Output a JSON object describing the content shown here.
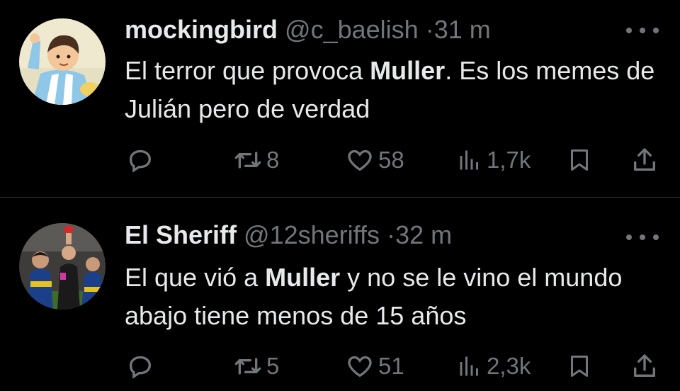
{
  "tweets": [
    {
      "name": "mockingbird",
      "handle": "@c_baelish",
      "separator": "·",
      "time": "31 m",
      "text_parts": [
        "El terror que provoca ",
        "Muller",
        ". Es los memes de Julián pero de verdad"
      ],
      "retweets": "8",
      "likes": "58",
      "views": "1,7k"
    },
    {
      "name": "El Sheriff",
      "handle": "@12sheriffs",
      "separator": "·",
      "time": "32 m",
      "text_parts": [
        "El que vió a ",
        "Muller",
        " y no se le vino el mundo abajo tiene menos de 15 años"
      ],
      "retweets": "5",
      "likes": "51",
      "views": "2,3k"
    }
  ],
  "icons": {
    "reply": "reply-icon",
    "retweet": "retweet-icon",
    "like": "heart-icon",
    "views": "views-icon",
    "bookmark": "bookmark-icon",
    "share": "share-icon",
    "more": "more-icon"
  },
  "colors": {
    "background": "#000000",
    "text": "#e7e9ea",
    "muted": "#71767b",
    "divider": "#2f3336"
  }
}
